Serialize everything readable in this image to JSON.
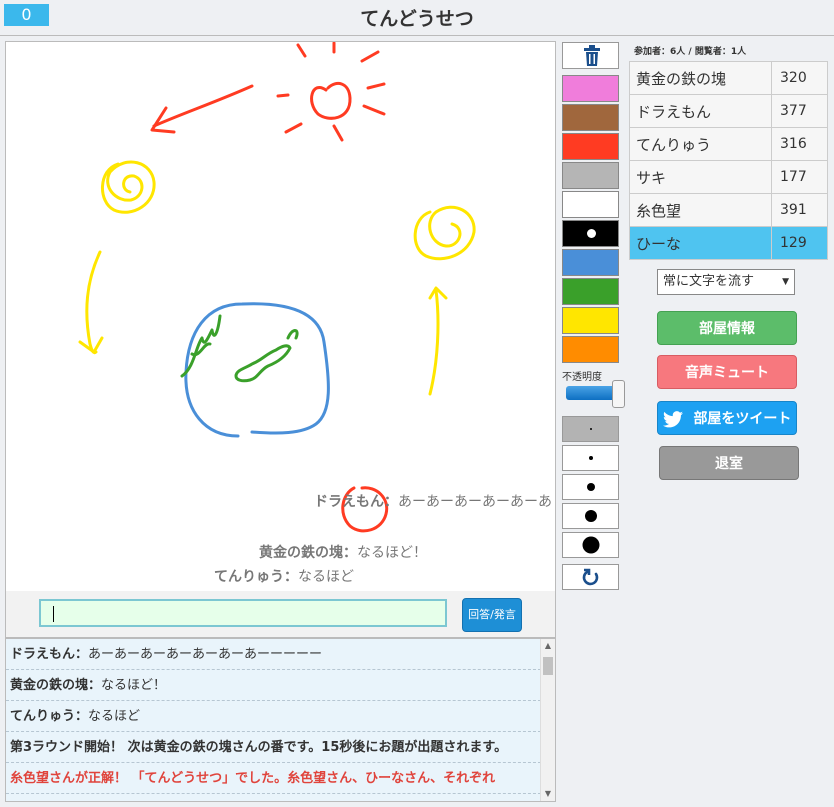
{
  "header": {
    "counter": "0",
    "title": "てんどうせつ"
  },
  "canvas": {
    "overlay_messages": [
      {
        "name": "ドラえもん",
        "sep": "：",
        "text": "あーあーあーあーあーあ"
      },
      {
        "name": "黄金の鉄の塊",
        "sep": "：",
        "text": "なるほど！"
      },
      {
        "name": "てんりゅう",
        "sep": "：",
        "text": "なるほど"
      }
    ]
  },
  "answer": {
    "value": "",
    "button_label": "回答/発言"
  },
  "log": [
    {
      "name": "ドラえもん",
      "sep": "：",
      "text": "あーあーあーあーあーあーあーーーーー"
    },
    {
      "name": "黄金の鉄の塊",
      "sep": "：",
      "text": "なるほど！"
    },
    {
      "name": "てんりゅう",
      "sep": "：",
      "text": "なるほど"
    },
    {
      "text": "第3ラウンド開始！ 次は黄金の鉄の塊さんの番です。15秒後にお題が出題されます。"
    },
    {
      "text": "糸色望さんが正解！ 「てんどうせつ」でした。糸色望さん、ひーなさん、それぞれ"
    }
  ],
  "palette": {
    "colors": [
      "#f07ddb",
      "#a0673d",
      "#ff3b22",
      "#b5b5b5",
      "#ffffff",
      "#000000",
      "#4a8fd8",
      "#3aa02a",
      "#ffe600",
      "#ff8c00"
    ],
    "opacity_label": "不透明度",
    "opacity": 1.0,
    "brush_sizes": [
      1,
      2,
      3,
      4,
      5
    ],
    "active_brush": 0
  },
  "room": {
    "counts": "参加者：6人 / 閲覧者：1人",
    "players": [
      {
        "name": "黄金の鉄の塊",
        "score": "320"
      },
      {
        "name": "ドラえもん",
        "score": "377"
      },
      {
        "name": "てんりゅう",
        "score": "316"
      },
      {
        "name": "サキ",
        "score": "177"
      },
      {
        "name": "糸色望",
        "score": "391"
      },
      {
        "name": "ひーな",
        "score": "129"
      }
    ],
    "active_player": 5,
    "scroll_mode": "常に文字を流す",
    "buttons": {
      "info": "部屋情報",
      "mute": "音声ミュート",
      "tweet": "部屋をツイート",
      "exit": "退室"
    }
  }
}
